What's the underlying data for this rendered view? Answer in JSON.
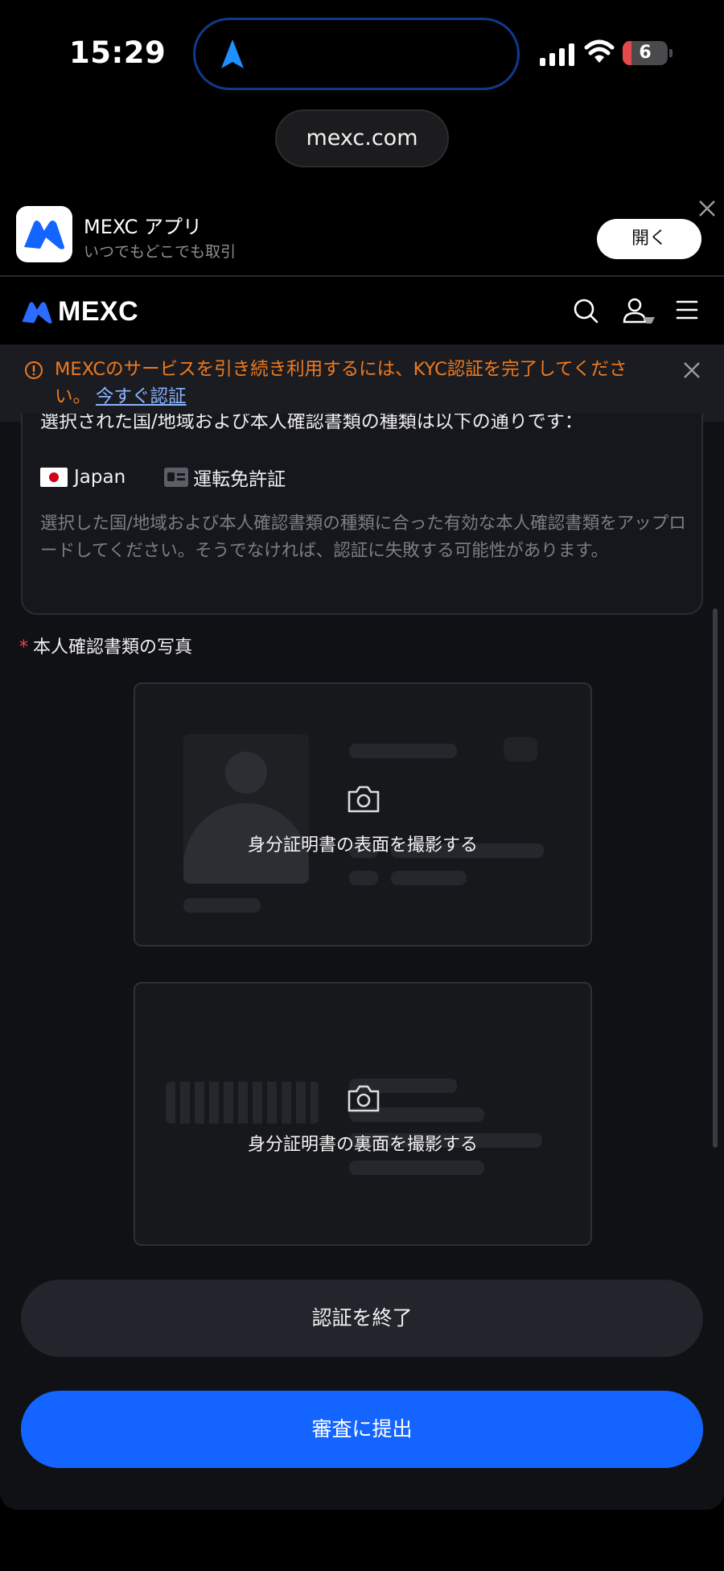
{
  "status_bar": {
    "time": "15:29",
    "battery": "6"
  },
  "browser": {
    "url": "mexc.com"
  },
  "app_banner": {
    "title": "MEXC アプリ",
    "subtitle": "いつでもどこでも取引",
    "open_label": "開く"
  },
  "header": {
    "logo_text": "MEXC"
  },
  "kyc_notice": {
    "message": "MEXCのサービスを引き続き利用するには、KYC認証を完了してください。",
    "link_label": "今すぐ認証"
  },
  "info_box": {
    "cut_heading": "選択された国/地域および本人確認書類の種類は以下の通りです：",
    "country": "Japan",
    "document_type": "運転免許証",
    "description": "選択した国/地域および本人確認書類の種類に合った有効な本人確認書類をアップロードしてください。そうでなければ、認証に失敗する可能性があります。"
  },
  "photo_section": {
    "required_mark": "*",
    "label": "本人確認書類の写真",
    "front_caption": "身分証明書の表面を撮影する",
    "back_caption": "身分証明書の裏面を撮影する"
  },
  "actions": {
    "end_label": "認証を終了",
    "submit_label": "審査に提出"
  },
  "colors": {
    "accent": "#1464ff",
    "warning": "#f07a1e",
    "link": "#8ab4ff"
  }
}
